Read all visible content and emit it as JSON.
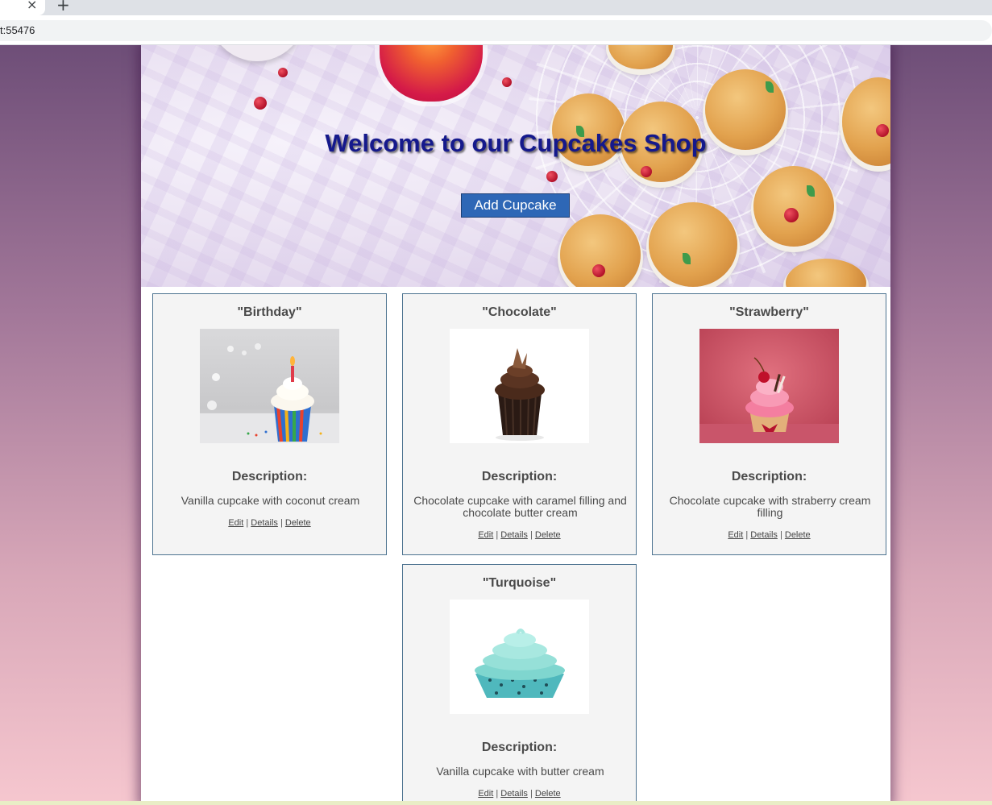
{
  "browser": {
    "tab_close": "×",
    "new_tab": "+",
    "url": "t:55476"
  },
  "hero": {
    "title": "Welcome to our Cupcakes Shop",
    "add_button": "Add Cupcake"
  },
  "cards": [
    {
      "name": "\"Birthday\"",
      "description_label": "Description:",
      "description": "Vanilla cupcake with coconut cream",
      "links": {
        "edit": "Edit",
        "details": "Details",
        "delete": "Delete",
        "sep": "|"
      }
    },
    {
      "name": "\"Chocolate\"",
      "description_label": "Description:",
      "description": "Chocolate cupcake with caramel filling and chocolate butter cream",
      "links": {
        "edit": "Edit",
        "details": "Details",
        "delete": "Delete",
        "sep": "|"
      }
    },
    {
      "name": "\"Strawberry\"",
      "description_label": "Description:",
      "description": "Chocolate cupcake with straberry cream filling",
      "links": {
        "edit": "Edit",
        "details": "Details",
        "delete": "Delete",
        "sep": "|"
      }
    },
    {
      "name": "\"Turquoise\"",
      "description_label": "Description:",
      "description": "Vanilla cupcake with butter cream",
      "links": {
        "edit": "Edit",
        "details": "Details",
        "delete": "Delete",
        "sep": "|"
      }
    }
  ],
  "colors": {
    "button": "#2e67b6",
    "title": "#15198c",
    "card_border": "#4d7390"
  }
}
